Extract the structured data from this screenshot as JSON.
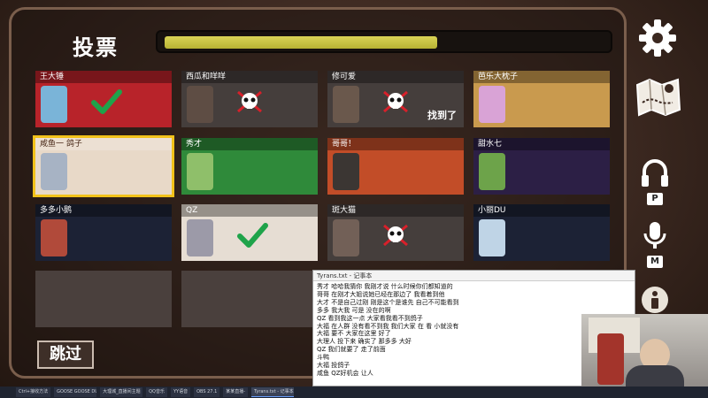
{
  "header": {
    "title": "投票",
    "timer_fill_fraction": 0.62
  },
  "players": [
    {
      "name": "王大锤",
      "bg": "#b8232a",
      "avatar": "#7ab4d8",
      "state": "voted"
    },
    {
      "name": "西瓜和咩咩",
      "bg": "#5b5552",
      "avatar": "#8d6b52",
      "state": "dead"
    },
    {
      "name": "修可爱",
      "bg": "#5b5552",
      "avatar": "#b08a6a",
      "state": "dead_found",
      "found_label": "找到了"
    },
    {
      "name": "芭乐大枕子",
      "bg": "#c99a4e",
      "avatar": "#d9a3d6",
      "state": "alive"
    },
    {
      "name": "咸鱼一    鸽子",
      "bg": "#e8d9c8",
      "avatar": "#a7b3c4",
      "state": "selected"
    },
    {
      "name": "秀才",
      "bg": "#2f8a3a",
      "avatar": "#8fbf6a",
      "state": "alive"
    },
    {
      "name": "哥哥！",
      "bg": "#c24d28",
      "avatar": "#3b3633",
      "state": "alive"
    },
    {
      "name": "甜水七",
      "bg": "#2c1f45",
      "avatar": "#6da34a",
      "state": "alive"
    },
    {
      "name": "多多小鹅",
      "bg": "#1c2235",
      "avatar": "#b14a3a",
      "state": "alive"
    },
    {
      "name": "QZ",
      "bg": "#e6ddd3",
      "avatar": "#9c9aa8",
      "state": "voted"
    },
    {
      "name": "斑大猫",
      "bg": "#5b5552",
      "avatar": "#c7a08a",
      "state": "dead"
    },
    {
      "name": "小丽DU",
      "bg": "#1c2235",
      "avatar": "#bfd4e6",
      "state": "alive"
    }
  ],
  "skip_label": "跳过",
  "side": {
    "mic_key": "P",
    "voice_key": "M"
  },
  "chat": {
    "title": "Tyrans.txt - 记事本",
    "lines": [
      "秀才 哈哈我猜你 我刚才说 什么时候你们都知道的",
      "哥哥 在刚才大姐说她已经在那边了 我看着到他",
      "大才 不是自己过刚 刚是这个是谁先 自己不可能看到",
      "多多 我大我 可是 没在的啊",
      "QZ 看到我这一点 大家看我看不到鸽子",
      "大福 在人群 没有看不到我 我们大家 在 看 小就没有",
      "大福 要不 大家在这里 好了",
      "大理人 投下来 确实了 那多多 大好",
      "QZ 我们就要了 走了前面",
      "斗鸭",
      "大福 投鸽子",
      "咸鱼 QZ好机会 让人"
    ]
  },
  "taskbar": [
    "Ctrl+接收方法",
    "GOOSE GOOSE DUCK",
    "大理城_直播间主题",
    "QQ音乐",
    "YY语音",
    "OBS 27.1",
    "某某直播-",
    "Tyrans.txt - 记事本"
  ]
}
